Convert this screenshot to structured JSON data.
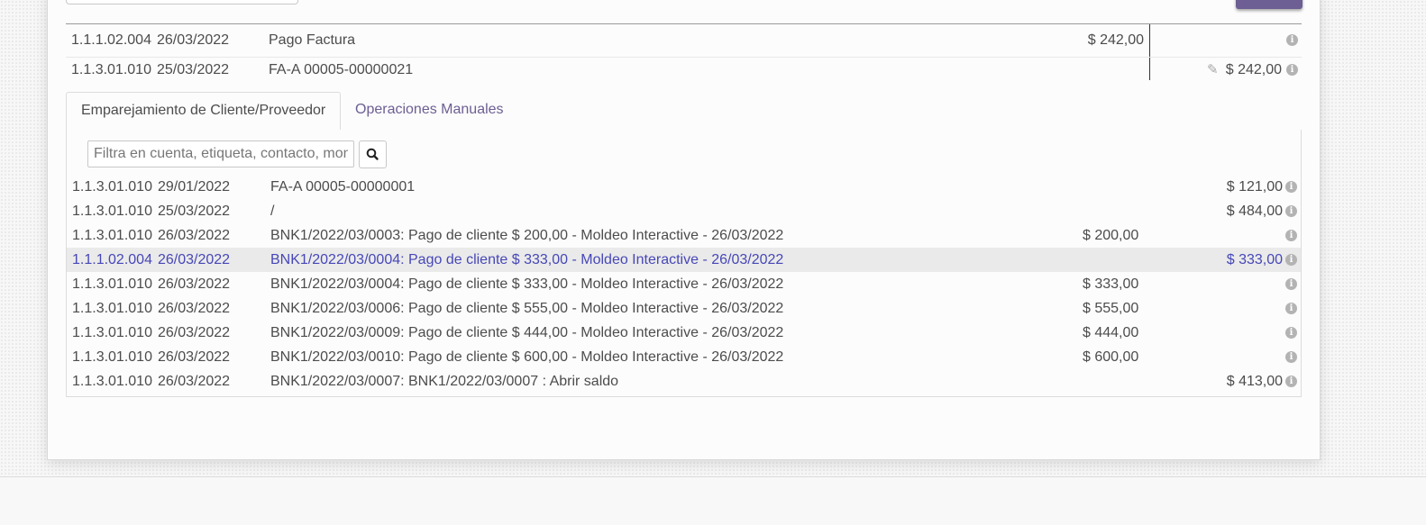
{
  "selected_lines": [
    {
      "account": "1.1.1.02.004",
      "date": "26/03/2022",
      "label": "Pago Factura",
      "debit": "$ 242,00",
      "credit": ""
    },
    {
      "account": "1.1.3.01.010",
      "date": "25/03/2022",
      "label": "FA-A 00005-00000021",
      "debit": "",
      "credit": "$ 242,00"
    }
  ],
  "tabs": {
    "matching": "Emparejamiento de Cliente/Proveedor",
    "manual": "Operaciones Manuales"
  },
  "search": {
    "placeholder": "Filtra en cuenta, etiqueta, contacto, monto,..."
  },
  "match_lines": [
    {
      "account": "1.1.3.01.010",
      "date": "29/01/2022",
      "label": "FA-A 00005-00000001",
      "debit": "",
      "credit": "$ 121,00"
    },
    {
      "account": "1.1.3.01.010",
      "date": "25/03/2022",
      "label": "/",
      "debit": "",
      "credit": "$ 484,00"
    },
    {
      "account": "1.1.3.01.010",
      "date": "26/03/2022",
      "label": "BNK1/2022/03/0003: Pago de cliente $ 200,00 - Moldeo Interactive - 26/03/2022",
      "debit": "$ 200,00",
      "credit": ""
    },
    {
      "account": "1.1.1.02.004",
      "date": "26/03/2022",
      "label": "BNK1/2022/03/0004: Pago de cliente $ 333,00 - Moldeo Interactive - 26/03/2022",
      "debit": "",
      "credit": "$ 333,00"
    },
    {
      "account": "1.1.3.01.010",
      "date": "26/03/2022",
      "label": "BNK1/2022/03/0004: Pago de cliente $ 333,00 - Moldeo Interactive - 26/03/2022",
      "debit": "$ 333,00",
      "credit": ""
    },
    {
      "account": "1.1.3.01.010",
      "date": "26/03/2022",
      "label": "BNK1/2022/03/0006: Pago de cliente $ 555,00 - Moldeo Interactive - 26/03/2022",
      "debit": "$ 555,00",
      "credit": ""
    },
    {
      "account": "1.1.3.01.010",
      "date": "26/03/2022",
      "label": "BNK1/2022/03/0009: Pago de cliente $ 444,00 - Moldeo Interactive - 26/03/2022",
      "debit": "$ 444,00",
      "credit": ""
    },
    {
      "account": "1.1.3.01.010",
      "date": "26/03/2022",
      "label": "BNK1/2022/03/0010: Pago de cliente $ 600,00 - Moldeo Interactive - 26/03/2022",
      "debit": "$ 600,00",
      "credit": ""
    },
    {
      "account": "1.1.3.01.010",
      "date": "26/03/2022",
      "label": "BNK1/2022/03/0007: BNK1/2022/03/0007 : Abrir saldo",
      "debit": "",
      "credit": "$ 413,00"
    }
  ],
  "colors": {
    "accent": "#6d5e93",
    "highlight_text": "#4747b8",
    "highlight_bg": "#eaeaea"
  },
  "icons": {
    "info": "info-circle-icon",
    "edit": "pencil-icon",
    "search": "search-icon"
  }
}
